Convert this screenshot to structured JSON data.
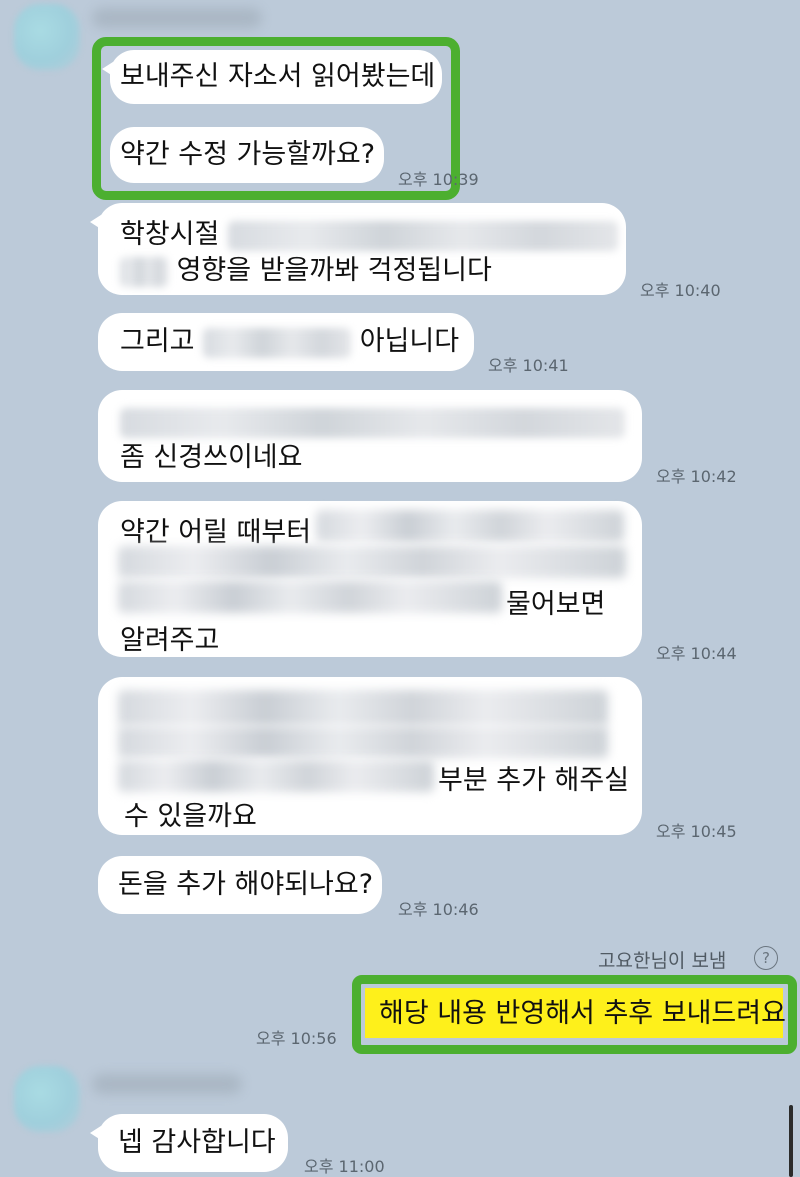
{
  "messages": [
    {
      "lines": [
        "보내주신 자소서 읽어봤는데",
        "약간 수정 가능할까요?"
      ],
      "time": "오후 10:39"
    },
    {
      "line1": "학창시절",
      "line2": "영향을 받을까봐 걱정됩니다",
      "time": "오후 10:40"
    },
    {
      "prefix": "그리고",
      "suffix": "아닙니다",
      "time": "오후 10:41"
    },
    {
      "line2": "좀 신경쓰이네요",
      "time": "오후 10:42"
    },
    {
      "line1": "약간 어릴 때부터",
      "line3_suffix": "물어보면",
      "line4": "알려주고",
      "time": "오후 10:44"
    },
    {
      "line2_suffix": "부분 추가 해주실",
      "line3": "수 있을까요",
      "time": "오후 10:45"
    },
    {
      "text": "돈을 추가 해야되나요?",
      "time": "오후 10:46"
    },
    {
      "sender_label": "고요한님이 보냄",
      "help_icon": "?",
      "text": "해당 내용 반영해서 추후 보내드려요",
      "time": "오후 10:56"
    },
    {
      "text": "넵 감사합니다",
      "time": "오후 11:00"
    }
  ],
  "colors": {
    "background": "#bccad9",
    "bubble_incoming": "#ffffff",
    "bubble_outgoing": "#fef01b",
    "highlight_border": "#4caf30"
  },
  "icons": {
    "help": "question-circle-icon",
    "avatar": "blurred-avatar"
  }
}
